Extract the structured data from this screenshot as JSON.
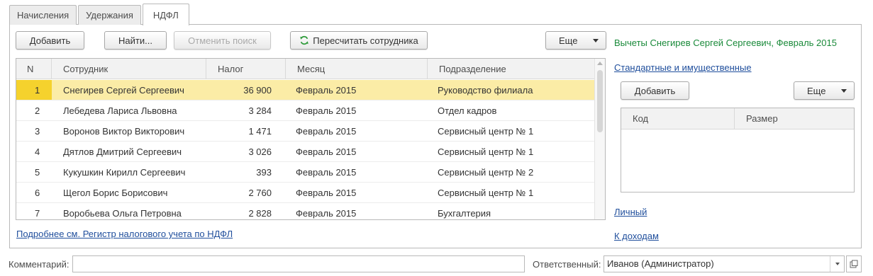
{
  "tabs": [
    {
      "label": "Начисления",
      "active": false
    },
    {
      "label": "Удержания",
      "active": false
    },
    {
      "label": "НДФЛ",
      "active": true
    }
  ],
  "toolbar": {
    "add_label": "Добавить",
    "find_label": "Найти...",
    "cancel_search_label": "Отменить поиск",
    "recalc_label": "Пересчитать сотрудника",
    "more_label": "Еще"
  },
  "grid": {
    "columns": [
      "N",
      "Сотрудник",
      "Налог",
      "Месяц",
      "Подразделение"
    ],
    "rows": [
      {
        "n": "1",
        "employee": "Снегирев Сергей Сергеевич",
        "tax": "36 900",
        "month": "Февраль 2015",
        "department": "Руководство филиала",
        "selected": true
      },
      {
        "n": "2",
        "employee": "Лебедева Лариса Львовна",
        "tax": "3 284",
        "month": "Февраль 2015",
        "department": "Отдел кадров",
        "selected": false
      },
      {
        "n": "3",
        "employee": "Воронов Виктор Викторович",
        "tax": "1 471",
        "month": "Февраль 2015",
        "department": "Сервисный центр № 1",
        "selected": false
      },
      {
        "n": "4",
        "employee": "Дятлов Дмитрий Сергеевич",
        "tax": "3 026",
        "month": "Февраль 2015",
        "department": "Сервисный центр № 1",
        "selected": false
      },
      {
        "n": "5",
        "employee": "Кукушкин Кирилл Сергеевич",
        "tax": "393",
        "month": "Февраль 2015",
        "department": "Сервисный центр № 2",
        "selected": false
      },
      {
        "n": "6",
        "employee": "Щегол Борис Борисович",
        "tax": "2 760",
        "month": "Февраль 2015",
        "department": "Сервисный центр № 1",
        "selected": false
      },
      {
        "n": "7",
        "employee": "Воробьева Ольга Петровна",
        "tax": "2 828",
        "month": "Февраль 2015",
        "department": "Бухгалтерия",
        "selected": false
      }
    ]
  },
  "register_link": "Подробнее см. Регистр налогового учета по НДФЛ",
  "deductions": {
    "title": "Вычеты Снегирев Сергей Сергеевич, Февраль 2015",
    "standard_link": "Стандартные и имущественные",
    "add_label": "Добавить",
    "more_label": "Еще",
    "columns": [
      "Код",
      "Размер"
    ],
    "personal_link": "Личный",
    "income_link": "К доходам"
  },
  "footer": {
    "comment_label": "Комментарий:",
    "comment_value": "",
    "responsible_label": "Ответственный:",
    "responsible_value": "Иванов (Администратор)"
  },
  "colors": {
    "selected_row": "#fbeca6",
    "selected_marker": "#f5d22d",
    "link": "#1f4e9c",
    "green_title": "#1a8a3a"
  },
  "icons": {
    "recalc": "refresh-icon",
    "more": "chevron-down-icon",
    "open": "open-form-icon"
  }
}
